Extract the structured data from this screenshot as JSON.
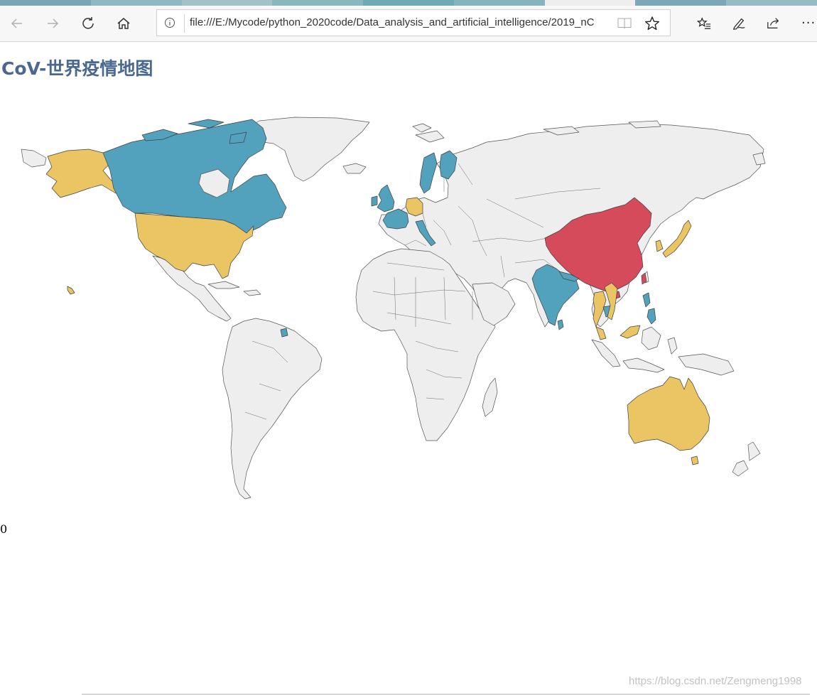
{
  "browser": {
    "url": "file:///E:/Mycode/python_2020code/Data_analysis_and_artificial_intelligence/2019_nC",
    "more_label": "···"
  },
  "page": {
    "title": "CoV-世界疫情地图",
    "footer_text": "0",
    "watermark": "https://blog.csdn.net/Zengmeng1998"
  },
  "legend_colors": {
    "highest": "#d64b5b",
    "medium": "#ebc563",
    "low": "#52a2bd",
    "none": "#eeeeee"
  },
  "highlighted_countries": {
    "red": [
      "China"
    ],
    "yellow": [
      "United States",
      "Alaska (US)",
      "Germany",
      "Japan",
      "South Korea",
      "Thailand",
      "Vietnam",
      "Malaysia",
      "Australia"
    ],
    "blue": [
      "Canada",
      "United Kingdom",
      "France",
      "Italy",
      "Sweden",
      "Finland",
      "India",
      "Nepal",
      "Cambodia",
      "Philippines",
      "Sri Lanka"
    ]
  }
}
